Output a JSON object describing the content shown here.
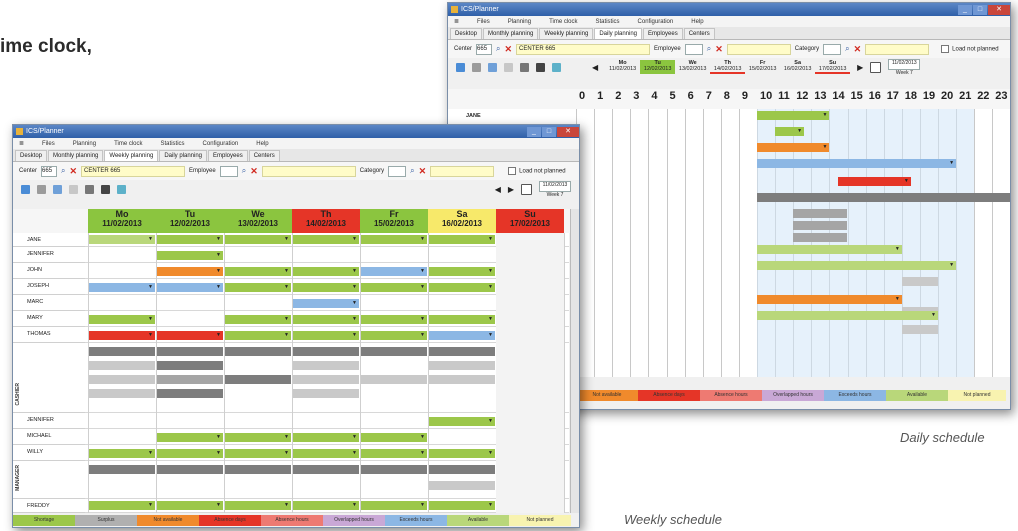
{
  "heading": "ime clock,",
  "captions": {
    "daily": "Daily schedule",
    "weekly": "Weekly schedule"
  },
  "app_title": "ICS/Planner",
  "menu": [
    "Files",
    "Planning",
    "Time clock",
    "Statistics",
    "Configuration",
    "Help"
  ],
  "tabs_weekly": [
    "Desktop",
    "Monthly planning",
    "Weekly planning",
    "Daily planning",
    "Employees",
    "Centers"
  ],
  "tabs_daily": [
    "Desktop",
    "Monthly planning",
    "Weekly planning",
    "Daily planning",
    "Employees",
    "Centers"
  ],
  "filters": {
    "center_label": "Center",
    "center_value": "665",
    "center_name": "CENTER 665",
    "employee_label": "Employee",
    "category_label": "Category",
    "load_label": "Load not planned"
  },
  "week_label": "Week 7",
  "date_value": "11/02/2013",
  "weekly_days": [
    {
      "d": "Mo",
      "date": "11/02/2013",
      "color": "#8bc53f"
    },
    {
      "d": "Tu",
      "date": "12/02/2013",
      "color": "#8bc53f"
    },
    {
      "d": "We",
      "date": "13/02/2013",
      "color": "#8bc53f"
    },
    {
      "d": "Th",
      "date": "14/02/2013",
      "color": "#e53527"
    },
    {
      "d": "Fr",
      "date": "15/02/2013",
      "color": "#8bc53f"
    },
    {
      "d": "Sa",
      "date": "16/02/2013",
      "color": "#f7e96a"
    },
    {
      "d": "Su",
      "date": "17/02/2013",
      "color": "#e53527"
    }
  ],
  "daily_days": [
    {
      "d": "Mo",
      "date": "11/02/2013"
    },
    {
      "d": "Tu",
      "date": "12/02/2013"
    },
    {
      "d": "We",
      "date": "13/02/2013"
    },
    {
      "d": "Th",
      "date": "14/02/2013"
    },
    {
      "d": "Fr",
      "date": "15/02/2013"
    },
    {
      "d": "Sa",
      "date": "16/02/2013"
    },
    {
      "d": "Su",
      "date": "17/02/2013"
    }
  ],
  "hours": [
    "0",
    "1",
    "2",
    "3",
    "4",
    "5",
    "6",
    "7",
    "8",
    "9",
    "10",
    "11",
    "12",
    "13",
    "14",
    "15",
    "16",
    "17",
    "18",
    "19",
    "20",
    "21",
    "22",
    "23"
  ],
  "employees": [
    "JANE",
    "JENNIFER",
    "JOHN",
    "JOSEPH",
    "MARC",
    "MARY",
    "THOMAS",
    "JENNIFER",
    "MICHAEL",
    "WILLY",
    "FREDDY"
  ],
  "groups": [
    "CASHIER",
    "MANAGER"
  ],
  "legend_weekly": [
    {
      "label": "Shortage",
      "color": "#9cc74a"
    },
    {
      "label": "Surplus",
      "color": "#b0b0b0"
    },
    {
      "label": "Not available",
      "color": "#f08a2c"
    },
    {
      "label": "Absence days",
      "color": "#e53527"
    },
    {
      "label": "Absence hours",
      "color": "#ee7a72"
    },
    {
      "label": "Overlapped hours",
      "color": "#c9a8d6"
    },
    {
      "label": "Exceeds hours",
      "color": "#8cb7e4"
    },
    {
      "label": "Available",
      "color": "#b9d77a"
    },
    {
      "label": "Not planned",
      "color": "#f8f3b0"
    }
  ],
  "legend_daily": [
    {
      "label": "Not available",
      "color": "#f08a2c"
    },
    {
      "label": "Absence days",
      "color": "#e53527"
    },
    {
      "label": "Absence hours",
      "color": "#ee7a72"
    },
    {
      "label": "Overlapped hours",
      "color": "#c9a8d6"
    },
    {
      "label": "Exceeds hours",
      "color": "#8cb7e4"
    },
    {
      "label": "Available",
      "color": "#b9d77a"
    },
    {
      "label": "Not planned",
      "color": "#f8f3b0"
    }
  ],
  "daily_name": "JANE"
}
